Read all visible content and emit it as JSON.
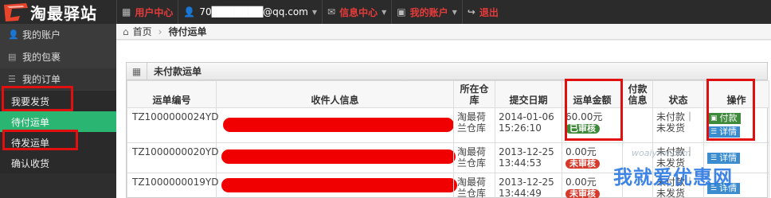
{
  "brand": {
    "logo_text": "淘最驿站"
  },
  "topbar": {
    "items": [
      {
        "label": "用户中心",
        "icon": "grid-icon",
        "red": true
      },
      {
        "label": "70███████@qq.com",
        "icon": "user-icon",
        "red": false
      },
      {
        "label": "信息中心",
        "icon": "envelope-icon",
        "red": true
      },
      {
        "label": "我的账户",
        "icon": "picture-icon",
        "red": true
      },
      {
        "label": "退出",
        "icon": "share-icon",
        "red": true
      }
    ]
  },
  "sidebar": {
    "items": [
      {
        "label": "我的账户",
        "icon": "user-icon"
      },
      {
        "label": "我的包裹",
        "icon": "package-icon"
      },
      {
        "label": "我的订单",
        "icon": "list-icon"
      }
    ],
    "sub_items": [
      {
        "label": "我要发货"
      },
      {
        "label": "待付运单"
      },
      {
        "label": "待发运单"
      },
      {
        "label": "确认收货"
      }
    ]
  },
  "breadcrumb": {
    "home": "首页",
    "current": "待付运单"
  },
  "panel": {
    "title": "未付款运单"
  },
  "table": {
    "headers": [
      "运单编号",
      "收件人信息",
      "所在仓库",
      "提交日期",
      "运单金额",
      "付款信息",
      "状态",
      "操作"
    ],
    "rows": [
      {
        "no": "TZ1000000024YD",
        "warehouse": "淘最荷兰仓库",
        "date": "2014-01-06",
        "time": "15:26:10",
        "amount": "60.00元",
        "badge": "已审核",
        "badge_color": "green",
        "status_line1": "未付款｜",
        "status_line2": "未发货",
        "ops": [
          "付款",
          "详情"
        ]
      },
      {
        "no": "TZ1000000020YD",
        "warehouse": "淘最荷兰仓库",
        "date": "2013-12-25",
        "time": "13:44:53",
        "amount": "0.00元",
        "badge": "未审核",
        "badge_color": "red",
        "status_line1": "未付款｜",
        "status_line2": "未发货",
        "ops": [
          "详情"
        ]
      },
      {
        "no": "TZ1000000019YD",
        "warehouse": "淘最荷兰仓库",
        "date": "2013-12-25",
        "time": "13:44:49",
        "amount": "0.00元",
        "badge": "未审核",
        "badge_color": "red",
        "status_line1": "未付款｜",
        "status_line2": "未发货",
        "ops": [
          "详情"
        ]
      }
    ]
  },
  "watermark": {
    "main": "我就爱优惠网",
    "sub": "woaiyhw.com"
  },
  "colors": {
    "accent_green": "#2bb573",
    "annotation_red": "#e01010",
    "topbar_bg": "#2b2b2b"
  }
}
